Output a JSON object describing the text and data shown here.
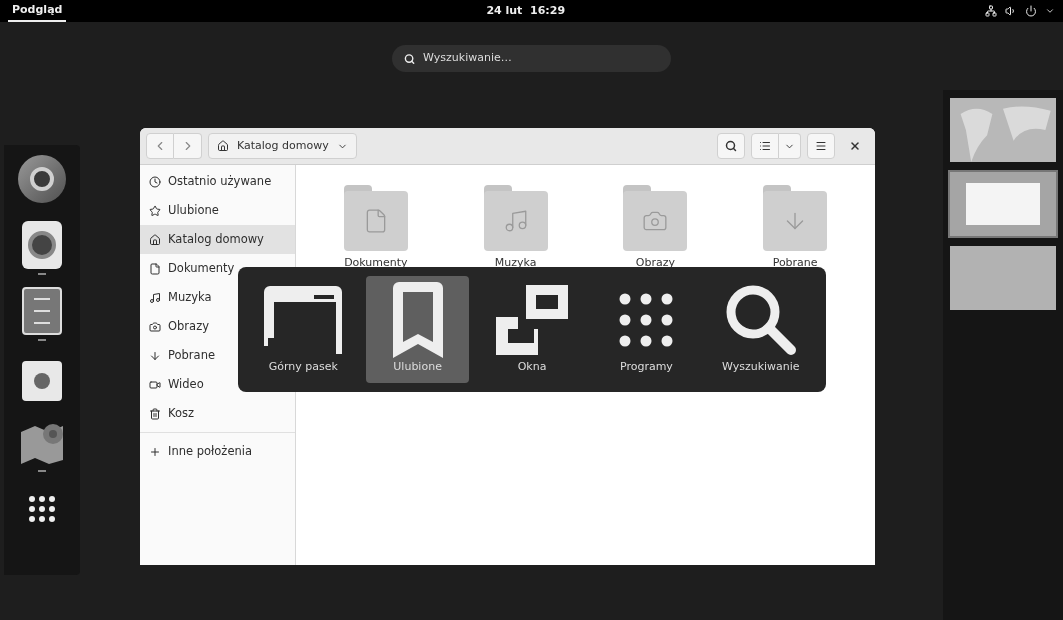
{
  "top_bar": {
    "activities": "Podgląd",
    "clock": "24 lut  16:29"
  },
  "search": {
    "placeholder": "Wyszukiwanie…"
  },
  "dock": {
    "apps": [
      {
        "kind": "browser",
        "running": false
      },
      {
        "kind": "speaker",
        "running": true
      },
      {
        "kind": "cabinet",
        "running": true
      },
      {
        "kind": "store",
        "running": false
      },
      {
        "kind": "maps",
        "running": true
      },
      {
        "kind": "grid",
        "running": false
      }
    ]
  },
  "file_window": {
    "location": "Katalog domowy",
    "sidebar": [
      {
        "kind": "clock",
        "label": "Ostatnio używane",
        "selected": false
      },
      {
        "kind": "star",
        "label": "Ulubione",
        "selected": false
      },
      {
        "kind": "home",
        "label": "Katalog domowy",
        "selected": true
      },
      {
        "kind": "file",
        "label": "Dokumenty",
        "selected": false
      },
      {
        "kind": "music",
        "label": "Muzyka",
        "selected": false
      },
      {
        "kind": "camera",
        "label": "Obrazy",
        "selected": false
      },
      {
        "kind": "down",
        "label": "Pobrane",
        "selected": false
      },
      {
        "kind": "video",
        "label": "Wideo",
        "selected": false
      },
      {
        "kind": "trash",
        "label": "Kosz",
        "selected": false
      },
      {
        "kind": "plus",
        "label": "Inne położenia",
        "selected": false
      }
    ],
    "folders": [
      {
        "kind": "file",
        "label": "Dokumenty"
      },
      {
        "kind": "music",
        "label": "Muzyka"
      },
      {
        "kind": "camera",
        "label": "Obrazy"
      },
      {
        "kind": "down",
        "label": "Pobrane"
      }
    ]
  },
  "switcher": [
    {
      "kind": "top-bar",
      "label": "Górny pasek",
      "selected": false
    },
    {
      "kind": "favorites",
      "label": "Ulubione",
      "selected": true
    },
    {
      "kind": "windows",
      "label": "Okna",
      "selected": false
    },
    {
      "kind": "apps",
      "label": "Programy",
      "selected": false
    },
    {
      "kind": "search",
      "label": "Wyszukiwanie",
      "selected": false
    }
  ],
  "workspaces": [
    {
      "kind": "map",
      "selected": false
    },
    {
      "kind": "window",
      "selected": true
    },
    {
      "kind": "plain",
      "selected": false
    }
  ]
}
